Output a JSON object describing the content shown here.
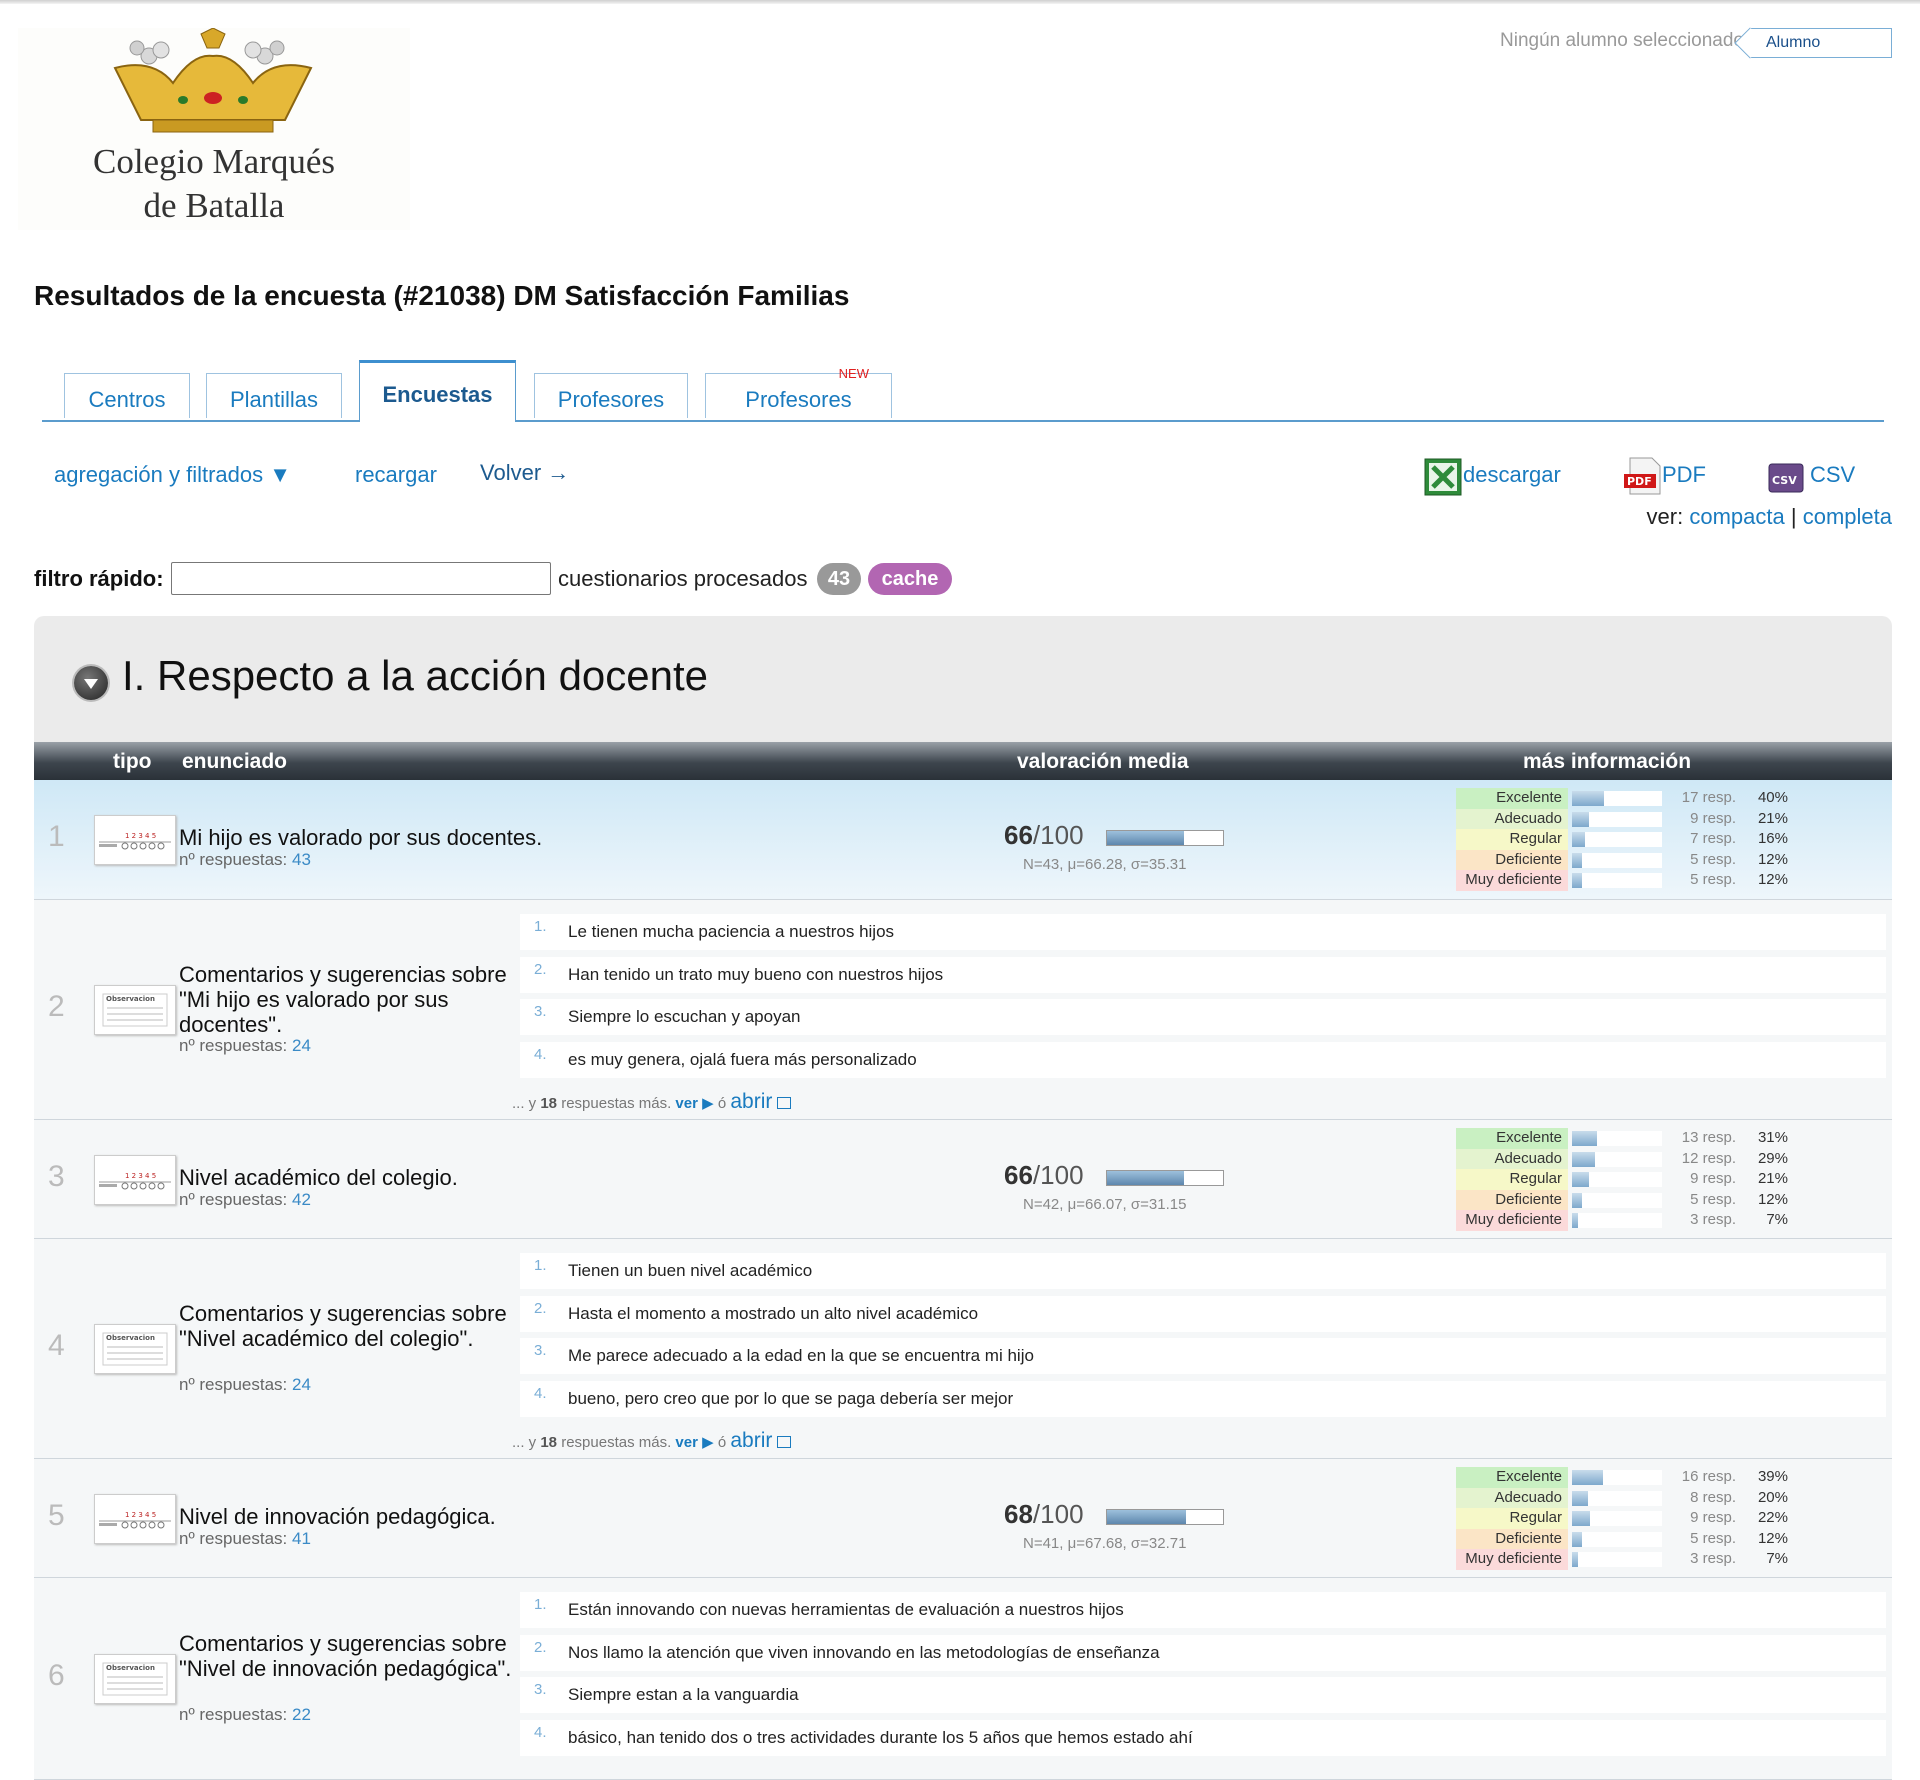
{
  "logo": {
    "line1": "Colegio Marqués",
    "line2": "de Batalla"
  },
  "student": {
    "status": "Ningún alumno seleccionado",
    "tag": "Alumno"
  },
  "title": "Resultados de la encuesta (#21038) DM Satisfacción Familias",
  "tabs": [
    {
      "label": "Centros"
    },
    {
      "label": "Plantillas"
    },
    {
      "label": "Encuestas"
    },
    {
      "label": "Profesores"
    },
    {
      "label": "Profesores",
      "badge": "NEW"
    }
  ],
  "toolbar": {
    "filters": "agregación y filtrados ▼",
    "reload": "recargar",
    "back": "Volver →",
    "download": "descargar",
    "pdf": "PDF",
    "csv": "CSV",
    "view_label": "ver:",
    "view_compact": "compacta",
    "view_sep": "|",
    "view_full": "completa"
  },
  "filter": {
    "label": "filtro rápido:",
    "value": "",
    "processed_label": "cuestionarios procesados",
    "processed_count": "43",
    "cache": "cache"
  },
  "section": {
    "title": "I. Respecto a la acción docente",
    "headers": {
      "type": "tipo",
      "statement": "enunciado",
      "rating": "valoración media",
      "info": "más información"
    }
  },
  "dist_colors": {
    "Excelente": "#c9f0c2",
    "Adecuado": "#e4f3cf",
    "Regular": "#f6f8c8",
    "Deficiente": "#fbe5c6",
    "Muy deficiente": "#fbdada"
  },
  "rows": [
    {
      "num": "1",
      "kind": "rating",
      "text": "Mi hijo es valorado por sus docentes.",
      "resp_label": "nº respuestas:",
      "resp": "43",
      "score": "66",
      "score_max": "/100",
      "score_frac": 0.66,
      "stats": "N=43, μ=66.28, σ=35.31",
      "dist": [
        {
          "label": "Excelente",
          "resp": "17 resp.",
          "pct": "40%",
          "frac": 0.4
        },
        {
          "label": "Adecuado",
          "resp": "9 resp.",
          "pct": "21%",
          "frac": 0.21
        },
        {
          "label": "Regular",
          "resp": "7 resp.",
          "pct": "16%",
          "frac": 0.16
        },
        {
          "label": "Deficiente",
          "resp": "5 resp.",
          "pct": "12%",
          "frac": 0.12
        },
        {
          "label": "Muy deficiente",
          "resp": "5 resp.",
          "pct": "12%",
          "frac": 0.12
        }
      ]
    },
    {
      "num": "2",
      "kind": "comments",
      "text": "Comentarios y sugerencias sobre \"Mi hijo es valorado por sus docentes\".",
      "resp_label": "nº respuestas:",
      "resp": "24",
      "comments": [
        "Le tienen mucha paciencia a nuestros hijos",
        "Han tenido un trato muy bueno con nuestros hijos",
        "Siempre lo escuchan y apoyan",
        "es muy genera, ojalá fuera más personalizado"
      ],
      "more": {
        "prefix": "... y",
        "count": "18",
        "suffix": "respuestas más.",
        "see": "ver ▶",
        "or": "ó",
        "open": "abrir"
      }
    },
    {
      "num": "3",
      "kind": "rating",
      "text": "Nivel académico del colegio.",
      "resp_label": "nº respuestas:",
      "resp": "42",
      "score": "66",
      "score_max": "/100",
      "score_frac": 0.66,
      "stats": "N=42, μ=66.07, σ=31.15",
      "dist": [
        {
          "label": "Excelente",
          "resp": "13 resp.",
          "pct": "31%",
          "frac": 0.31
        },
        {
          "label": "Adecuado",
          "resp": "12 resp.",
          "pct": "29%",
          "frac": 0.29
        },
        {
          "label": "Regular",
          "resp": "9 resp.",
          "pct": "21%",
          "frac": 0.21
        },
        {
          "label": "Deficiente",
          "resp": "5 resp.",
          "pct": "12%",
          "frac": 0.12
        },
        {
          "label": "Muy deficiente",
          "resp": "3 resp.",
          "pct": "7%",
          "frac": 0.07
        }
      ]
    },
    {
      "num": "4",
      "kind": "comments",
      "text": "Comentarios y sugerencias sobre \"Nivel académico del colegio\".",
      "resp_label": "nº respuestas:",
      "resp": "24",
      "comments": [
        "Tienen un buen nivel académico",
        "Hasta el momento a mostrado un alto nivel académico",
        "Me parece adecuado a la edad en la que se encuentra mi hijo",
        "bueno, pero creo que por lo que se paga debería ser mejor"
      ],
      "more": {
        "prefix": "... y",
        "count": "18",
        "suffix": "respuestas más.",
        "see": "ver ▶",
        "or": "ó",
        "open": "abrir"
      }
    },
    {
      "num": "5",
      "kind": "rating",
      "text": "Nivel de innovación pedagógica.",
      "resp_label": "nº respuestas:",
      "resp": "41",
      "score": "68",
      "score_max": "/100",
      "score_frac": 0.68,
      "stats": "N=41, μ=67.68, σ=32.71",
      "dist": [
        {
          "label": "Excelente",
          "resp": "16 resp.",
          "pct": "39%",
          "frac": 0.39
        },
        {
          "label": "Adecuado",
          "resp": "8 resp.",
          "pct": "20%",
          "frac": 0.2
        },
        {
          "label": "Regular",
          "resp": "9 resp.",
          "pct": "22%",
          "frac": 0.22
        },
        {
          "label": "Deficiente",
          "resp": "5 resp.",
          "pct": "12%",
          "frac": 0.12
        },
        {
          "label": "Muy deficiente",
          "resp": "3 resp.",
          "pct": "7%",
          "frac": 0.07
        }
      ]
    },
    {
      "num": "6",
      "kind": "comments",
      "text": "Comentarios y sugerencias sobre \"Nivel de innovación pedagógica\".",
      "resp_label": "nº respuestas:",
      "resp": "22",
      "comments": [
        "Están innovando con nuevas herramientas de evaluación a nuestros hijos",
        "Nos llamo la atención que viven innovando en las metodologías de enseñanza",
        "Siempre estan a la vanguardia",
        "básico, han tenido dos o tres actividades durante los 5 años que hemos estado ahí"
      ]
    }
  ]
}
